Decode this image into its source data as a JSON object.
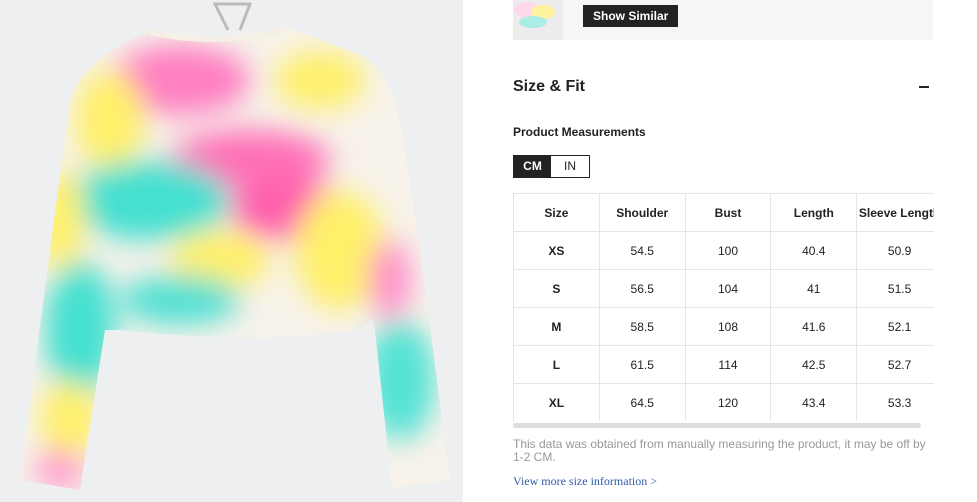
{
  "similar": {
    "show_similar_label": "Show Similar"
  },
  "size_fit": {
    "title": "Size & Fit",
    "measurements_label": "Product Measurements",
    "units": [
      "CM",
      "IN"
    ],
    "active_unit": "CM"
  },
  "table": {
    "headers": [
      "Size",
      "Shoulder",
      "Bust",
      "Length",
      "Sleeve Length"
    ],
    "rows": [
      [
        "XS",
        "54.5",
        "100",
        "40.4",
        "50.9"
      ],
      [
        "S",
        "56.5",
        "104",
        "41",
        "51.5"
      ],
      [
        "M",
        "58.5",
        "108",
        "41.6",
        "52.1"
      ],
      [
        "L",
        "61.5",
        "114",
        "42.5",
        "52.7"
      ],
      [
        "XL",
        "64.5",
        "120",
        "43.4",
        "53.3"
      ]
    ]
  },
  "disclaimer": "This data was obtained from manually measuring the product, it may be off by 1-2 CM.",
  "more_link": "View more size information >",
  "icons": {
    "collapse": "minus-icon"
  },
  "colors": {
    "accent": "#222222",
    "link": "#2f5aa8"
  }
}
